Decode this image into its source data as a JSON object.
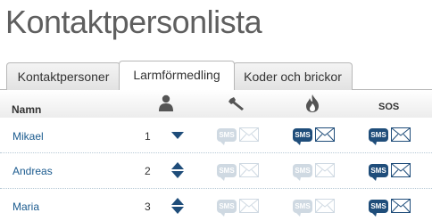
{
  "page": {
    "title": "Kontaktpersonlista"
  },
  "tabs": [
    {
      "label": "Kontaktpersoner",
      "active": false
    },
    {
      "label": "Larmförmedling",
      "active": true
    },
    {
      "label": "Koder och brickor",
      "active": false
    }
  ],
  "table": {
    "header": {
      "name": "Namn",
      "sos": "SOS",
      "person_icon": "person-icon",
      "tech_icon": "wrench-icon",
      "fire_icon": "flame-icon"
    },
    "sms_label": "SMS",
    "rows": [
      {
        "name": "Mikael",
        "order": "1",
        "tech": "off",
        "fire": "on",
        "sos": "on"
      },
      {
        "name": "Andreas",
        "order": "2",
        "tech": "off",
        "fire": "off",
        "sos": "on"
      },
      {
        "name": "Maria",
        "order": "3",
        "tech": "off",
        "fire": "off",
        "sos": "on"
      }
    ]
  },
  "colors": {
    "active_channel": "#1f4d7a",
    "inactive_channel": "#cfd9e2",
    "link": "#1a5a8e",
    "arrow": "#1f4d7a"
  }
}
